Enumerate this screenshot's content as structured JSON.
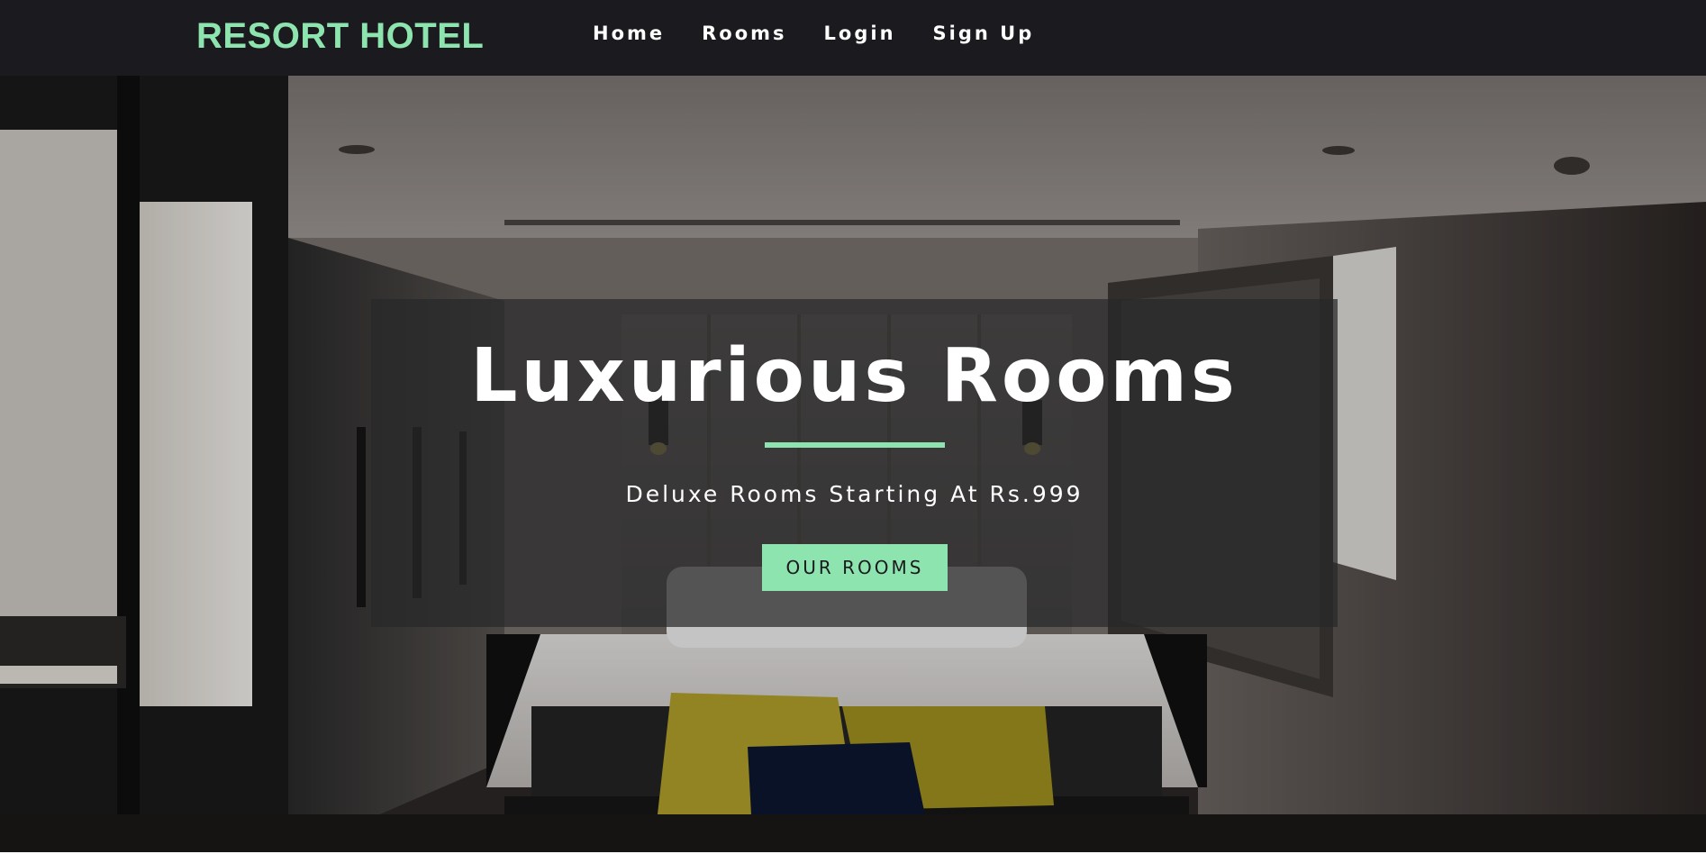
{
  "brand": {
    "name": "RESORT HOTEL"
  },
  "nav": {
    "items": [
      {
        "label": "Home"
      },
      {
        "label": "Rooms"
      },
      {
        "label": "Login"
      },
      {
        "label": "Sign Up"
      }
    ]
  },
  "hero": {
    "title": "Luxurious Rooms",
    "subtitle": "Deluxe Rooms Starting At Rs.999",
    "cta_label": "OUR ROOMS",
    "background_image": "hotel-bedroom-photo"
  },
  "colors": {
    "navbar_bg": "#1a1a1f",
    "accent": "#8ee4af",
    "text_light": "#ffffff",
    "overlay": "rgba(40,40,42,0.72)"
  }
}
